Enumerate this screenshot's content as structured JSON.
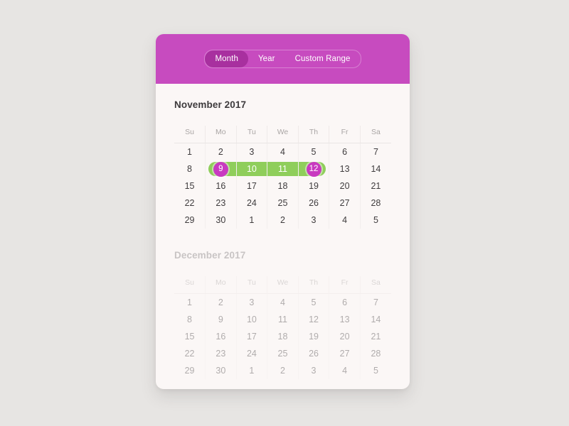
{
  "header": {
    "tabs": [
      {
        "label": "Month",
        "active": true
      },
      {
        "label": "Year",
        "active": false
      },
      {
        "label": "Custom Range",
        "active": false
      }
    ],
    "accent_color": "#c74bbf",
    "active_tab_color": "#a8309f"
  },
  "theme": {
    "page_background": "#e7e5e3",
    "card_background": "#fbf7f6",
    "range_color": "#8fce5b",
    "endpoint_color": "#c83ac0",
    "text_color": "#3f3c3e",
    "muted_text_color": "#c3ccd8"
  },
  "weekdays": [
    "Su",
    "Mo",
    "Tu",
    "We",
    "Th",
    "Fr",
    "Sa"
  ],
  "months": [
    {
      "title": "November 2017",
      "faded": false,
      "weeks": [
        [
          {
            "day": "1",
            "muted": false,
            "state": "normal"
          },
          {
            "day": "2",
            "muted": false,
            "state": "normal"
          },
          {
            "day": "3",
            "muted": false,
            "state": "normal"
          },
          {
            "day": "4",
            "muted": false,
            "state": "normal"
          },
          {
            "day": "5",
            "muted": false,
            "state": "normal"
          },
          {
            "day": "6",
            "muted": false,
            "state": "normal"
          },
          {
            "day": "7",
            "muted": false,
            "state": "normal"
          }
        ],
        [
          {
            "day": "8",
            "muted": false,
            "state": "normal"
          },
          {
            "day": "9",
            "muted": false,
            "state": "range-start"
          },
          {
            "day": "10",
            "muted": false,
            "state": "in-range"
          },
          {
            "day": "11",
            "muted": false,
            "state": "in-range"
          },
          {
            "day": "12",
            "muted": false,
            "state": "range-end"
          },
          {
            "day": "13",
            "muted": false,
            "state": "normal"
          },
          {
            "day": "14",
            "muted": false,
            "state": "normal"
          }
        ],
        [
          {
            "day": "15",
            "muted": false,
            "state": "normal"
          },
          {
            "day": "16",
            "muted": false,
            "state": "normal"
          },
          {
            "day": "17",
            "muted": false,
            "state": "normal"
          },
          {
            "day": "18",
            "muted": false,
            "state": "normal"
          },
          {
            "day": "19",
            "muted": false,
            "state": "normal"
          },
          {
            "day": "20",
            "muted": false,
            "state": "normal"
          },
          {
            "day": "21",
            "muted": false,
            "state": "normal"
          }
        ],
        [
          {
            "day": "22",
            "muted": false,
            "state": "normal"
          },
          {
            "day": "23",
            "muted": false,
            "state": "normal"
          },
          {
            "day": "24",
            "muted": false,
            "state": "normal"
          },
          {
            "day": "25",
            "muted": false,
            "state": "normal"
          },
          {
            "day": "26",
            "muted": false,
            "state": "normal"
          },
          {
            "day": "27",
            "muted": false,
            "state": "normal"
          },
          {
            "day": "28",
            "muted": false,
            "state": "normal"
          }
        ],
        [
          {
            "day": "29",
            "muted": false,
            "state": "normal"
          },
          {
            "day": "30",
            "muted": false,
            "state": "normal"
          },
          {
            "day": "1",
            "muted": true,
            "state": "normal"
          },
          {
            "day": "2",
            "muted": true,
            "state": "normal"
          },
          {
            "day": "3",
            "muted": true,
            "state": "normal"
          },
          {
            "day": "4",
            "muted": true,
            "state": "normal"
          },
          {
            "day": "5",
            "muted": true,
            "state": "normal"
          }
        ]
      ]
    },
    {
      "title": "December 2017",
      "faded": true,
      "weeks": [
        [
          {
            "day": "1",
            "muted": false,
            "state": "normal"
          },
          {
            "day": "2",
            "muted": false,
            "state": "normal"
          },
          {
            "day": "3",
            "muted": false,
            "state": "normal"
          },
          {
            "day": "4",
            "muted": false,
            "state": "normal"
          },
          {
            "day": "5",
            "muted": false,
            "state": "normal"
          },
          {
            "day": "6",
            "muted": false,
            "state": "normal"
          },
          {
            "day": "7",
            "muted": false,
            "state": "normal"
          }
        ],
        [
          {
            "day": "8",
            "muted": false,
            "state": "normal"
          },
          {
            "day": "9",
            "muted": false,
            "state": "normal"
          },
          {
            "day": "10",
            "muted": false,
            "state": "normal"
          },
          {
            "day": "11",
            "muted": false,
            "state": "normal"
          },
          {
            "day": "12",
            "muted": false,
            "state": "normal"
          },
          {
            "day": "13",
            "muted": false,
            "state": "normal"
          },
          {
            "day": "14",
            "muted": false,
            "state": "normal"
          }
        ],
        [
          {
            "day": "15",
            "muted": false,
            "state": "normal"
          },
          {
            "day": "16",
            "muted": false,
            "state": "normal"
          },
          {
            "day": "17",
            "muted": false,
            "state": "normal"
          },
          {
            "day": "18",
            "muted": false,
            "state": "normal"
          },
          {
            "day": "19",
            "muted": false,
            "state": "normal"
          },
          {
            "day": "20",
            "muted": false,
            "state": "normal"
          },
          {
            "day": "21",
            "muted": false,
            "state": "normal"
          }
        ],
        [
          {
            "day": "22",
            "muted": false,
            "state": "normal"
          },
          {
            "day": "23",
            "muted": false,
            "state": "normal"
          },
          {
            "day": "24",
            "muted": false,
            "state": "normal"
          },
          {
            "day": "25",
            "muted": false,
            "state": "normal"
          },
          {
            "day": "26",
            "muted": false,
            "state": "normal"
          },
          {
            "day": "27",
            "muted": false,
            "state": "normal"
          },
          {
            "day": "28",
            "muted": false,
            "state": "normal"
          }
        ],
        [
          {
            "day": "29",
            "muted": false,
            "state": "normal"
          },
          {
            "day": "30",
            "muted": false,
            "state": "normal"
          },
          {
            "day": "1",
            "muted": true,
            "state": "normal"
          },
          {
            "day": "2",
            "muted": true,
            "state": "normal"
          },
          {
            "day": "3",
            "muted": true,
            "state": "normal"
          },
          {
            "day": "4",
            "muted": true,
            "state": "normal"
          },
          {
            "day": "5",
            "muted": true,
            "state": "normal"
          }
        ]
      ]
    }
  ]
}
